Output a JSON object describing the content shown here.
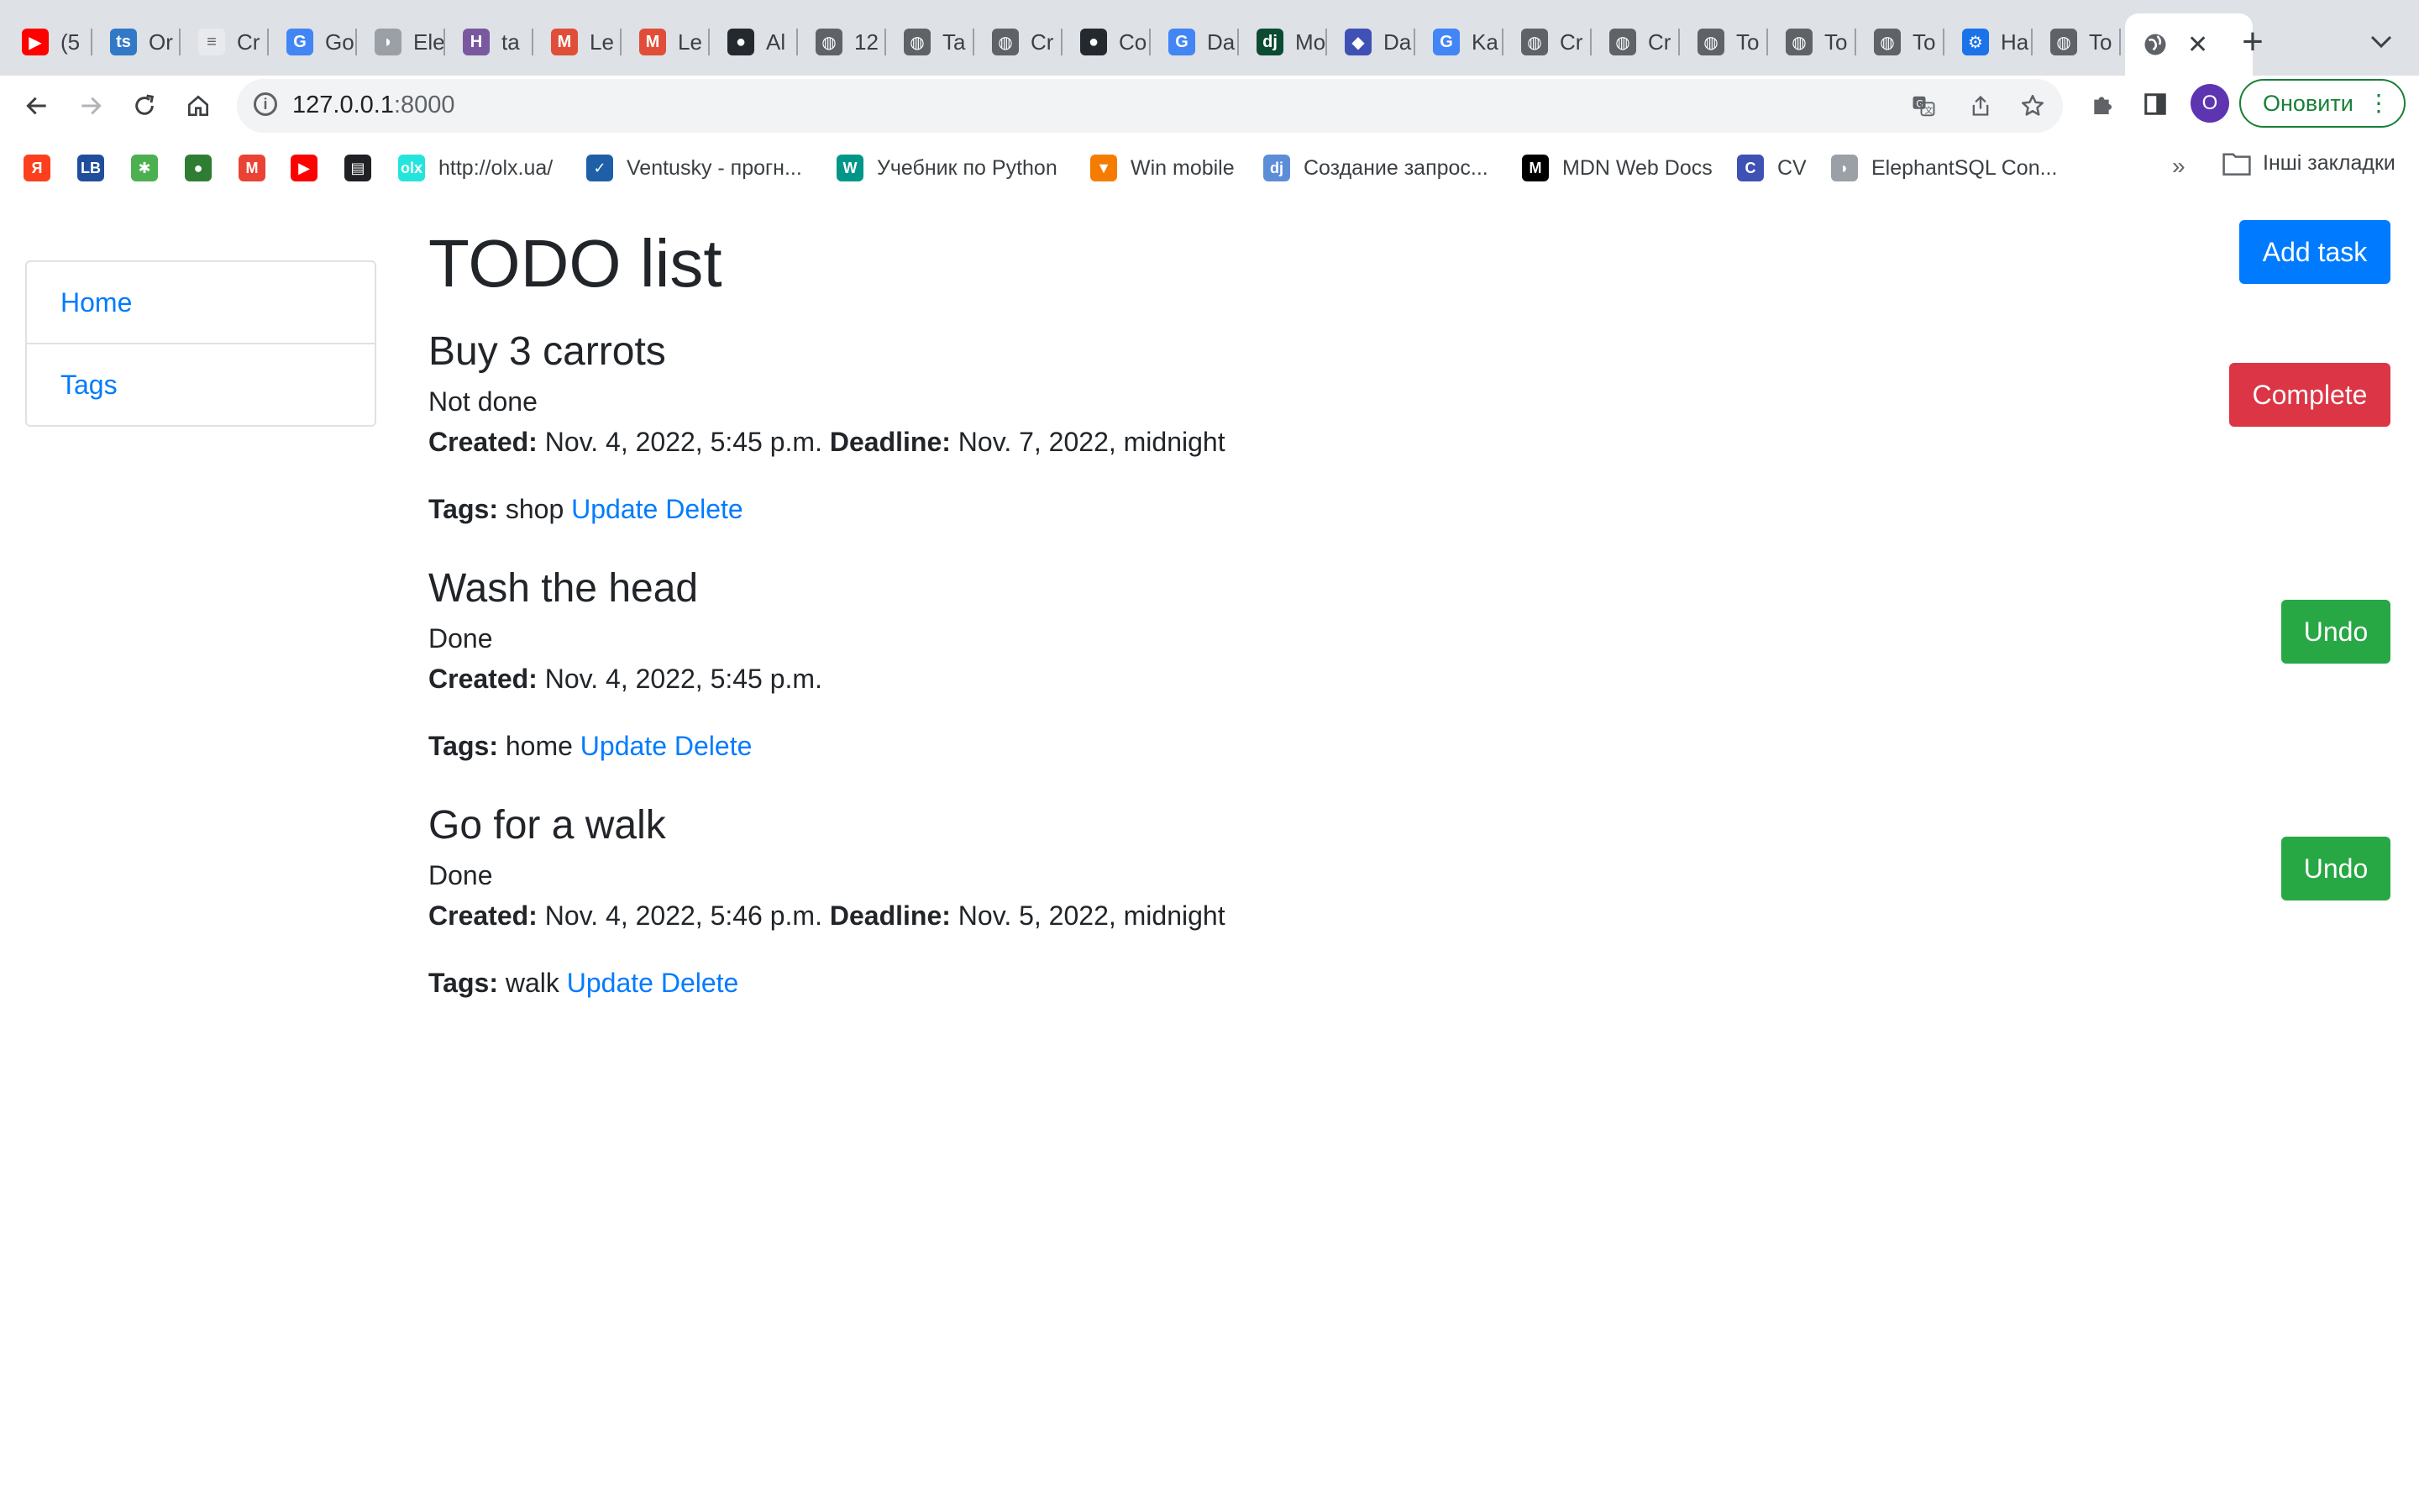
{
  "browser": {
    "tabs": [
      {
        "title": "(5",
        "icon": "youtube-icon",
        "color": "#ff0000"
      },
      {
        "title": "Or",
        "icon": "ts-icon",
        "color": "#3178c6"
      },
      {
        "title": "Cr",
        "icon": "doc-icon",
        "color": "#e8eaed"
      },
      {
        "title": "Go",
        "icon": "google-translate-icon",
        "color": "#4285f4"
      },
      {
        "title": "Ele",
        "icon": "elephant-icon",
        "color": "#9aa0a6"
      },
      {
        "title": "ta",
        "icon": "heroku-icon",
        "color": "#79589f"
      },
      {
        "title": "Le",
        "icon": "metanit-icon",
        "color": "#e04e39"
      },
      {
        "title": "Le",
        "icon": "metanit-icon",
        "color": "#e04e39"
      },
      {
        "title": "Al",
        "icon": "github-icon",
        "color": "#24292f"
      },
      {
        "title": "12",
        "icon": "globe-icon",
        "color": "#5f6368"
      },
      {
        "title": "Ta",
        "icon": "globe-icon",
        "color": "#5f6368"
      },
      {
        "title": "Cr",
        "icon": "globe-icon",
        "color": "#5f6368"
      },
      {
        "title": "Co",
        "icon": "github-icon",
        "color": "#24292f"
      },
      {
        "title": "Da",
        "icon": "google-icon",
        "color": "#4285f4"
      },
      {
        "title": "Mo",
        "icon": "django-icon",
        "color": "#0c4b33"
      },
      {
        "title": "Da",
        "icon": "diamond-icon",
        "color": "#3f51b5"
      },
      {
        "title": "Ka",
        "icon": "google-icon",
        "color": "#4285f4"
      },
      {
        "title": "Cr",
        "icon": "globe-icon",
        "color": "#5f6368"
      },
      {
        "title": "Cr",
        "icon": "globe-icon",
        "color": "#5f6368"
      },
      {
        "title": "To",
        "icon": "globe-icon",
        "color": "#5f6368"
      },
      {
        "title": "To",
        "icon": "globe-icon",
        "color": "#5f6368"
      },
      {
        "title": "To",
        "icon": "globe-icon",
        "color": "#5f6368"
      },
      {
        "title": "Ha",
        "icon": "gear-icon",
        "color": "#1a73e8"
      },
      {
        "title": "To",
        "icon": "globe-icon",
        "color": "#5f6368"
      }
    ],
    "active_tab_icon": "globe-icon",
    "active_tab_close": "✕",
    "new_tab": "+",
    "url_host": "127.0.0.1",
    "url_port": ":8000",
    "update_label": "Оновити",
    "profile_initial": "O",
    "bookmarks": [
      {
        "label": "",
        "icon": "yandex-icon",
        "color": "#fc3f1d"
      },
      {
        "label": "",
        "icon": "lb-icon",
        "color": "#1f4e9c"
      },
      {
        "label": "",
        "icon": "star-logo-icon",
        "color": "#4caf50"
      },
      {
        "label": "",
        "icon": "green-globe-icon",
        "color": "#2e7d32"
      },
      {
        "label": "",
        "icon": "gmail-icon",
        "color": "#ea4335"
      },
      {
        "label": "",
        "icon": "youtube-icon",
        "color": "#ff0000"
      },
      {
        "label": "",
        "icon": "printer-icon",
        "color": "#202124"
      },
      {
        "label": "http://olx.ua/",
        "icon": "olx-icon",
        "color": "#23e5db"
      },
      {
        "label": "Ventusky - прогн...",
        "icon": "ventusky-icon",
        "color": "#1e5fa8"
      },
      {
        "label": "Учебник по Python",
        "icon": "w-icon",
        "color": "#009688"
      },
      {
        "label": "Win mobile",
        "icon": "win-mobile-icon",
        "color": "#f57c00"
      },
      {
        "label": "Создание запрос...",
        "icon": "dj-icon",
        "color": "#5c8ed8"
      },
      {
        "label": "MDN Web Docs",
        "icon": "mdn-icon",
        "color": "#000000"
      },
      {
        "label": "CV",
        "icon": "cv-icon",
        "color": "#3f51b5"
      },
      {
        "label": "ElephantSQL Con...",
        "icon": "elephant-icon",
        "color": "#9aa0a6"
      }
    ],
    "bookmarks_more": "»",
    "other_bookmarks": "Інші закладки"
  },
  "sidebar": {
    "items": [
      {
        "label": "Home"
      },
      {
        "label": "Tags"
      }
    ]
  },
  "main": {
    "title": "TODO list",
    "add_task_label": "Add task",
    "tasks": [
      {
        "title": "Buy 3 carrots",
        "status": "Not done",
        "created_label": "Created:",
        "created": "Nov. 4, 2022, 5:45 p.m.",
        "deadline_label": "Deadline:",
        "deadline": "Nov. 7, 2022, midnight",
        "tags_label": "Tags:",
        "tags": "shop",
        "update_label": "Update",
        "delete_label": "Delete",
        "action_label": "Complete"
      },
      {
        "title": "Wash the head",
        "status": "Done",
        "created_label": "Created:",
        "created": "Nov. 4, 2022, 5:45 p.m.",
        "deadline_label": "",
        "deadline": "",
        "tags_label": "Tags:",
        "tags": "home",
        "update_label": "Update",
        "delete_label": "Delete",
        "action_label": "Undo"
      },
      {
        "title": "Go for a walk",
        "status": "Done",
        "created_label": "Created:",
        "created": "Nov. 4, 2022, 5:46 p.m.",
        "deadline_label": "Deadline:",
        "deadline": "Nov. 5, 2022, midnight",
        "tags_label": "Tags:",
        "tags": "walk",
        "update_label": "Update",
        "delete_label": "Delete",
        "action_label": "Undo"
      }
    ]
  },
  "colors": {
    "primary": "#007bff",
    "danger": "#dc3545",
    "success": "#28a745",
    "text": "#212529"
  }
}
